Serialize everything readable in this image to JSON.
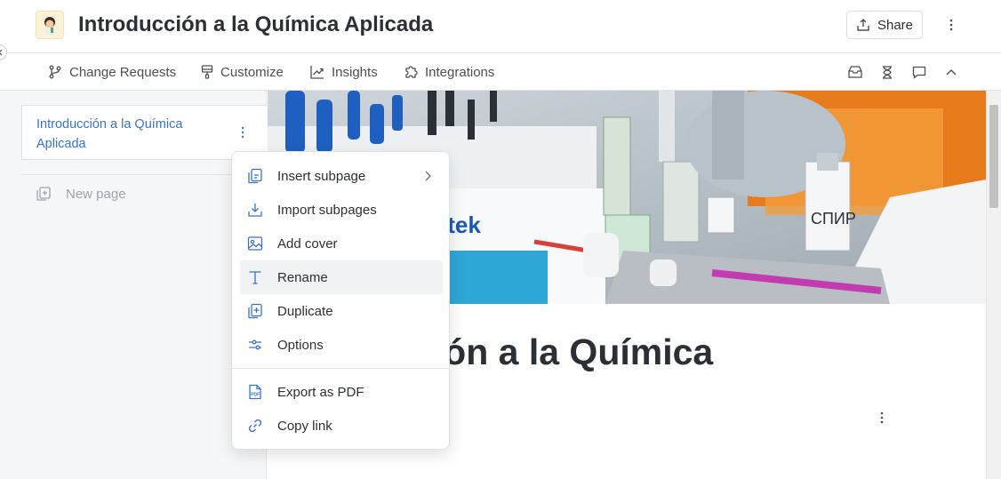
{
  "header": {
    "space_title": "Introducción a la Química Aplicada",
    "share_label": "Share"
  },
  "nav": {
    "items": [
      {
        "label": "Change Requests",
        "icon": "branch-icon"
      },
      {
        "label": "Customize",
        "icon": "paint-brush-icon"
      },
      {
        "label": "Insights",
        "icon": "trend-chart-icon"
      },
      {
        "label": "Integrations",
        "icon": "puzzle-icon"
      }
    ],
    "right_icons": [
      "inbox-icon",
      "hourglass-icon",
      "comment-icon",
      "chevron-up-icon"
    ]
  },
  "sidebar": {
    "page_title": "Introducción a la Química Aplicada",
    "new_page_label": "New page"
  },
  "main": {
    "heading": "Introducción a la Química Aplicada"
  },
  "context_menu": {
    "items": [
      {
        "label": "Insert subpage",
        "icon": "insert-page-icon",
        "has_submenu": true
      },
      {
        "label": "Import subpages",
        "icon": "import-icon"
      },
      {
        "label": "Add cover",
        "icon": "image-icon"
      },
      {
        "label": "Rename",
        "icon": "text-icon",
        "highlighted": true
      },
      {
        "label": "Duplicate",
        "icon": "duplicate-icon"
      },
      {
        "label": "Options",
        "icon": "sliders-icon"
      },
      {
        "label": "Export as PDF",
        "icon": "pdf-icon"
      },
      {
        "label": "Copy link",
        "icon": "link-icon"
      }
    ]
  },
  "colors": {
    "accent": "#3772cf",
    "text": "#2b2f36",
    "menu_icon": "#3772cf"
  }
}
